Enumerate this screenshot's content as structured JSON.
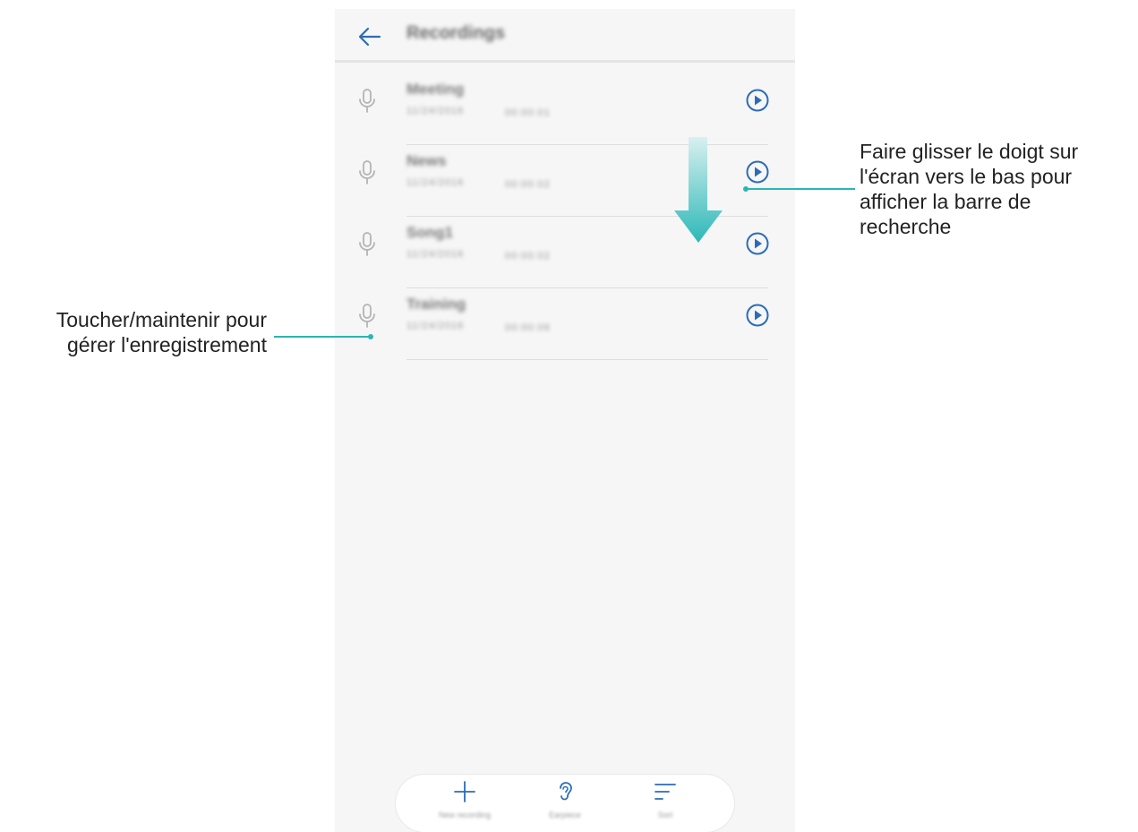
{
  "header": {
    "title": "Recordings",
    "back_icon": "arrow-left-icon"
  },
  "recordings": [
    {
      "name": "Meeting",
      "date": "11/24/2016",
      "time": "00:00:01"
    },
    {
      "name": "News",
      "date": "11/24/2016",
      "time": "00:00:02"
    },
    {
      "name": "Song1",
      "date": "11/24/2016",
      "time": "00:00:02"
    },
    {
      "name": "Training",
      "date": "11/24/2016",
      "time": "00:00:06"
    }
  ],
  "bottom_bar": {
    "new_recording": "New recording",
    "earpiece": "Earpiece",
    "sort": "Sort"
  },
  "callouts": {
    "swipe_lines": [
      "Faire glisser le doigt sur",
      "l'écran vers le bas pour",
      "afficher la barre de",
      "recherche"
    ],
    "hold_lines": [
      "Toucher/maintenir pour",
      "gérer l'enregistrement"
    ]
  },
  "colors": {
    "accent": "#2b6cb7",
    "callout_line": "#2cb5b5",
    "arrow_top": "#d8f0f0",
    "arrow_bottom": "#2db8b8",
    "icon_gray": "#b4b4b4"
  }
}
